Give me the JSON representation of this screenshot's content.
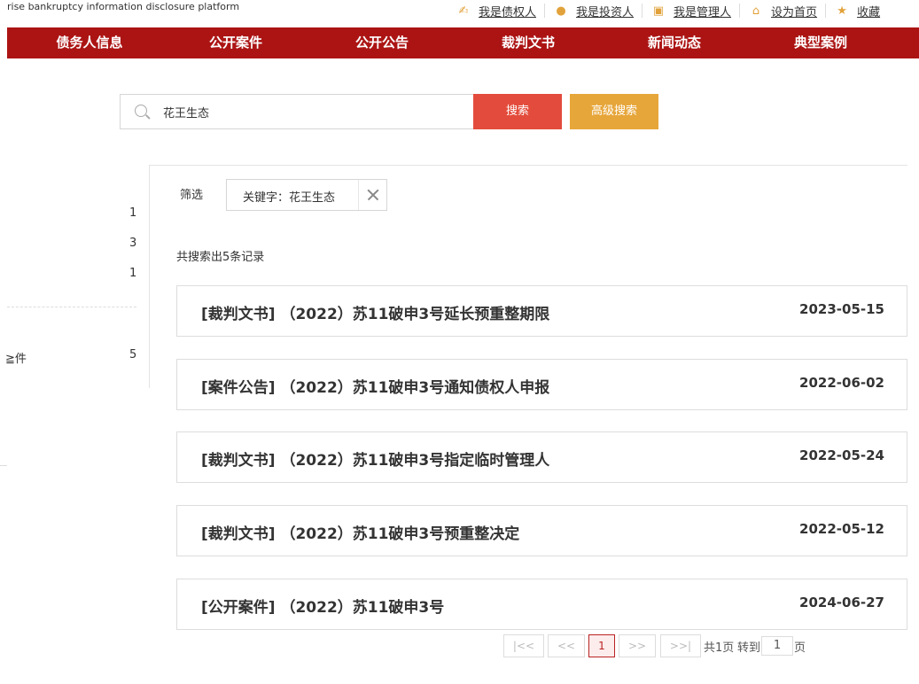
{
  "header": {
    "site_name": "rise bankruptcy  information disclosure platform",
    "links": [
      {
        "icon": "creditor-icon",
        "glyph": "✍",
        "label": "我是债权人"
      },
      {
        "icon": "investor-icon",
        "glyph": "●",
        "label": "我是投资人"
      },
      {
        "icon": "administrator-icon",
        "glyph": "▣",
        "label": "我是管理人"
      },
      {
        "icon": "home-icon",
        "glyph": "⌂",
        "label": "设为首页"
      },
      {
        "icon": "star-icon",
        "glyph": "★",
        "label": "收藏"
      }
    ]
  },
  "nav": {
    "items": [
      "债务人信息",
      "公开案件",
      "公开公告",
      "裁判文书",
      "新闻动态",
      "典型案例"
    ]
  },
  "search": {
    "value": "花王生态",
    "search_button": "搜索",
    "advanced_button": "高级搜索"
  },
  "sidebar": {
    "counts": [
      "1",
      "3",
      "1"
    ],
    "partial_label": "≧件",
    "partial_count": "5"
  },
  "filter": {
    "label": "筛选",
    "chip": "关键字：花王生态"
  },
  "results": {
    "count_text": "共搜索出5条记录",
    "items": [
      {
        "title": "[裁判文书] （2022）苏11破申3号延长预重整期限",
        "date": "2023-05-15"
      },
      {
        "title": "[案件公告] （2022）苏11破申3号通知债权人申报",
        "date": "2022-06-02"
      },
      {
        "title": "[裁判文书] （2022）苏11破申3号指定临时管理人",
        "date": "2022-05-24"
      },
      {
        "title": "[裁判文书] （2022）苏11破申3号预重整决定",
        "date": "2022-05-12"
      },
      {
        "title": "[公开案件] （2022）苏11破申3号",
        "date": "2024-06-27"
      }
    ]
  },
  "pagination": {
    "first": "|<<",
    "prev": "<<",
    "current": "1",
    "next": ">>",
    "last": ">>|",
    "total": "共1页",
    "goto": "转到",
    "goto_value": "1",
    "suffix": "页"
  },
  "colors": {
    "nav_bg": "#ac1414",
    "search_button": "#e34c3c",
    "advanced_button": "#e7a63a",
    "icon_accent": "#e2a23b"
  }
}
